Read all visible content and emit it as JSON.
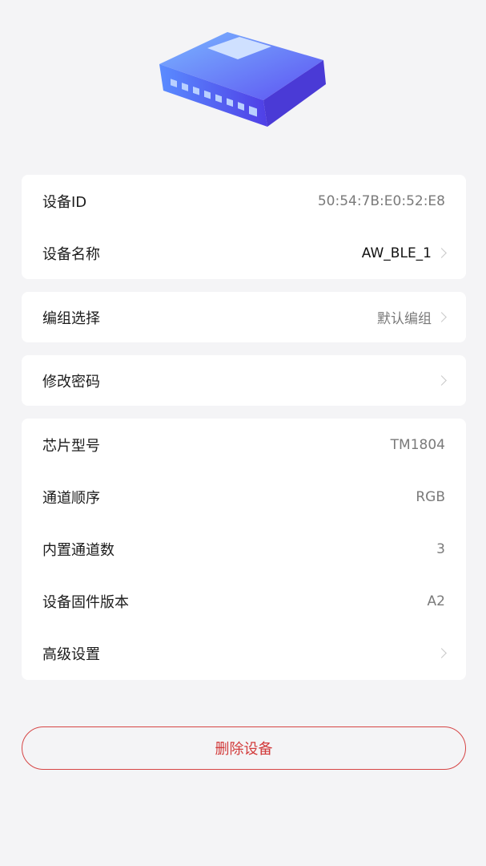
{
  "device_info": {
    "id_label": "设备ID",
    "id_value": "50:54:7B:E0:52:E8",
    "name_label": "设备名称",
    "name_value": "AW_BLE_1"
  },
  "group": {
    "label": "编组选择",
    "value": "默认编组"
  },
  "password": {
    "label": "修改密码"
  },
  "specs": {
    "chip_label": "芯片型号",
    "chip_value": "TM1804",
    "channel_order_label": "通道顺序",
    "channel_order_value": "RGB",
    "builtin_channels_label": "内置通道数",
    "builtin_channels_value": "3",
    "firmware_label": "设备固件版本",
    "firmware_value": "A2",
    "advanced_label": "高级设置"
  },
  "delete_button": {
    "label": "删除设备"
  },
  "colors": {
    "device_gradient_start": "#6aa8ff",
    "device_gradient_end": "#5b4cf0",
    "danger": "#d23b3b"
  },
  "icons": {
    "device": "controller-device-icon",
    "chevron": "chevron-right-icon"
  }
}
